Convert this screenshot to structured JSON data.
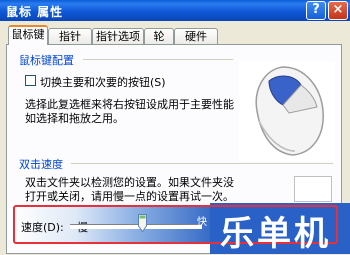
{
  "window": {
    "title": "鼠标 属性",
    "help_label": "?",
    "close_label": "×"
  },
  "tabs": [
    {
      "label": "鼠标键"
    },
    {
      "label": "指针"
    },
    {
      "label": "指针选项"
    },
    {
      "label": "轮"
    },
    {
      "label": "硬件"
    }
  ],
  "buttons_group": {
    "title": "鼠标键配置",
    "checkbox_label": "切换主要和次要的按钮(S)",
    "desc_line1": "选择此复选框来将右按钮设成用于主要性能",
    "desc_line2": "如选择和拖放之用。"
  },
  "dblclick_group": {
    "title": "双击速度",
    "desc_line1": "双击文件夹以检测您的设置。如果文件夹没",
    "desc_line2": "打开或关闭，请用慢一点的设置再试一次。",
    "speed_label": "速度(D):",
    "slow_label": "慢",
    "fast_label": "快",
    "speed_level": 0.55
  },
  "watermark": {
    "text": "乐单机"
  },
  "colors": {
    "accent": "#e8303a",
    "group_title": "#0046d5",
    "title_bar": "#0a5fd8"
  }
}
